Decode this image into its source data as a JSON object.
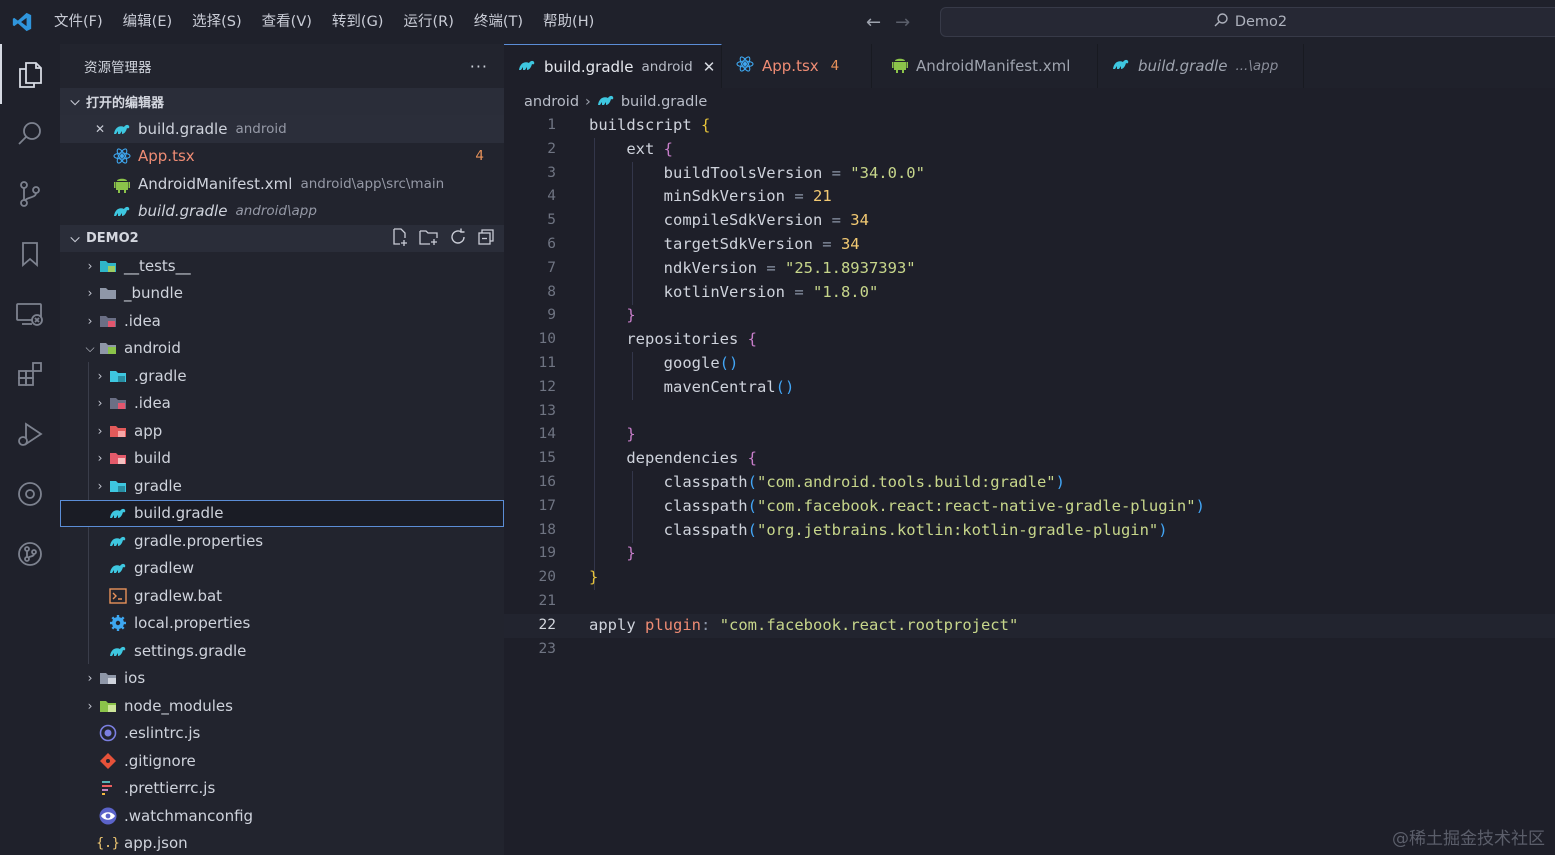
{
  "menubar": [
    "文件(F)",
    "编辑(E)",
    "选择(S)",
    "查看(V)",
    "转到(G)",
    "运行(R)",
    "终端(T)",
    "帮助(H)"
  ],
  "command_center": {
    "label": "Demo2"
  },
  "sidebar": {
    "title": "资源管理器",
    "more": "···",
    "open_editors": {
      "title": "打开的编辑器",
      "items": [
        {
          "name": "build.gradle",
          "desc": "android"
        },
        {
          "name": "App.tsx",
          "desc": "",
          "badge": "4"
        },
        {
          "name": "AndroidManifest.xml",
          "desc": "android\\app\\src\\main"
        },
        {
          "name": "build.gradle",
          "desc": "android\\app"
        }
      ]
    },
    "project": {
      "title": "DEMO2",
      "items": [
        "__tests__",
        "_bundle",
        ".idea",
        "android",
        ".gradle",
        ".idea",
        "app",
        "build",
        "gradle",
        "build.gradle",
        "gradle.properties",
        "gradlew",
        "gradlew.bat",
        "local.properties",
        "settings.gradle",
        "ios",
        "node_modules",
        ".eslintrc.js",
        ".gitignore",
        ".prettierrc.js",
        ".watchmanconfig",
        "app.json"
      ]
    }
  },
  "tabs": [
    {
      "name": "build.gradle",
      "desc": "android",
      "close": "✕"
    },
    {
      "name": "App.tsx",
      "badge": "4"
    },
    {
      "name": "AndroidManifest.xml"
    },
    {
      "name": "build.gradle",
      "desc": "...\\app"
    }
  ],
  "breadcrumbs": {
    "folder": "android",
    "file": "build.gradle"
  },
  "editor": {
    "line_numbers": [
      "1",
      "2",
      "3",
      "4",
      "5",
      "6",
      "7",
      "8",
      "9",
      "10",
      "11",
      "12",
      "13",
      "14",
      "15",
      "16",
      "17",
      "18",
      "19",
      "20",
      "21",
      "22",
      "23"
    ],
    "current_line": "22",
    "code": {
      "l1": "buildscript",
      "l2": "ext",
      "l3_key": "buildToolsVersion",
      "l3_val": "\"34.0.0\"",
      "l4_key": "minSdkVersion",
      "l4_val": "21",
      "l5_key": "compileSdkVersion",
      "l5_val": "34",
      "l6_key": "targetSdkVersion",
      "l6_val": "34",
      "l7_key": "ndkVersion",
      "l7_val": "\"25.1.8937393\"",
      "l8_key": "kotlinVersion",
      "l8_val": "\"1.8.0\"",
      "l10": "repositories",
      "l11": "google",
      "l12": "mavenCentral",
      "l15": "dependencies",
      "l16_fn": "classpath",
      "l16_val": "\"com.android.tools.build:gradle\"",
      "l17_fn": "classpath",
      "l17_val": "\"com.facebook.react:react-native-gradle-plugin\"",
      "l18_fn": "classpath",
      "l18_val": "\"org.jetbrains.kotlin:kotlin-gradle-plugin\"",
      "l22_a": "apply",
      "l22_b": "plugin",
      "l22_val": "\"com.facebook.react.rootproject\""
    }
  },
  "watermark": "@稀土掘金技术社区",
  "colors": {
    "accent": "#5b8dd6",
    "string": "#c7d68b",
    "number": "#f3ca73",
    "keyword": "#ef8c74",
    "badge": "#e8925a"
  }
}
